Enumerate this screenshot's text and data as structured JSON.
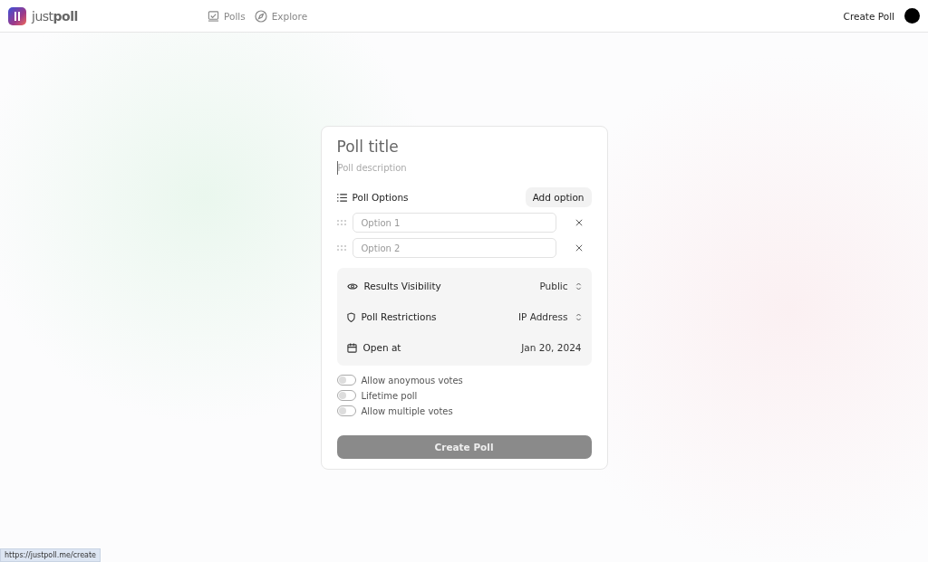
{
  "header": {
    "logo": "just**poll**",
    "nav": [
      {
        "label": "Polls",
        "selected": false
      },
      {
        "label": "Explore",
        "selected": false
      }
    ],
    "create_link": "Create Poll"
  },
  "form": {
    "title_placeholder": "Poll title",
    "description_placeholder": "Poll description",
    "options_heading": "Poll Options",
    "add_option": "Add option",
    "options": [
      {
        "placeholder": "Option 1"
      },
      {
        "placeholder": "Option 2"
      }
    ],
    "settings": [
      {
        "kind": "select",
        "label": "Results Visibility",
        "value": "Public"
      },
      {
        "kind": "select",
        "label": "Poll Restrictions",
        "value": "IP Address"
      },
      {
        "kind": "date",
        "label": "Open at",
        "value": "Jan 20, 2024"
      }
    ],
    "toggles": [
      {
        "label": "Allow anoymous votes",
        "on": false
      },
      {
        "label": "Lifetime poll",
        "on": false
      },
      {
        "label": "Allow multiple votes",
        "on": false
      }
    ],
    "submit": {
      "label": "Create Poll",
      "disabled": true
    }
  },
  "status_url": "https://justpoll.me/create"
}
